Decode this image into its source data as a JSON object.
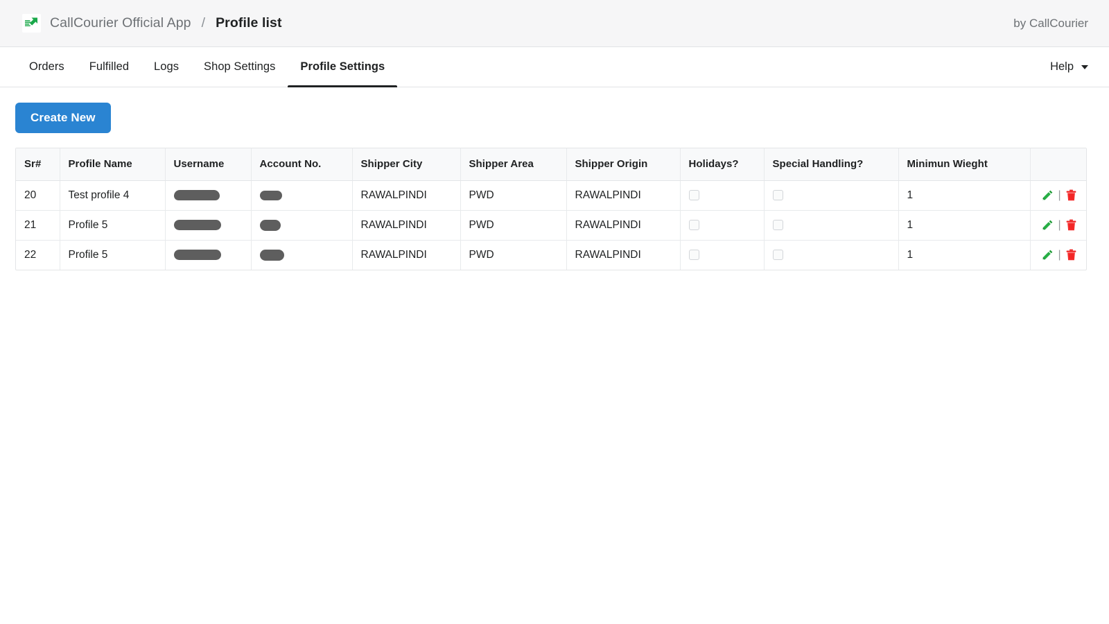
{
  "header": {
    "logo_alt": "CallCourier logo",
    "app_name": "CallCourier Official App",
    "separator": "/",
    "page_title": "Profile list",
    "byline": "by CallCourier"
  },
  "nav": {
    "tabs": [
      {
        "label": "Orders",
        "active": false
      },
      {
        "label": "Fulfilled",
        "active": false
      },
      {
        "label": "Logs",
        "active": false
      },
      {
        "label": "Shop Settings",
        "active": false
      },
      {
        "label": "Profile Settings",
        "active": true
      }
    ],
    "help_label": "Help"
  },
  "toolbar": {
    "create_label": "Create New"
  },
  "table": {
    "columns": [
      "Sr#",
      "Profile Name",
      "Username",
      "Account No.",
      "Shipper City",
      "Shipper Area",
      "Shipper Origin",
      "Holidays?",
      "Special Handling?",
      "Minimun Wieght",
      ""
    ],
    "rows": [
      {
        "sr": "20",
        "profile_name": "Test profile 4",
        "username": "",
        "account_no": "",
        "shipper_city": "RAWALPINDI",
        "shipper_area": "PWD",
        "shipper_origin": "RAWALPINDI",
        "holidays": false,
        "special_handling": false,
        "minimum_weight": "1"
      },
      {
        "sr": "21",
        "profile_name": "Profile 5",
        "username": "",
        "account_no": "",
        "shipper_city": "RAWALPINDI",
        "shipper_area": "PWD",
        "shipper_origin": "RAWALPINDI",
        "holidays": false,
        "special_handling": false,
        "minimum_weight": "1"
      },
      {
        "sr": "22",
        "profile_name": "Profile 5",
        "username": "",
        "account_no": "",
        "shipper_city": "RAWALPINDI",
        "shipper_area": "PWD",
        "shipper_origin": "RAWALPINDI",
        "holidays": false,
        "special_handling": false,
        "minimum_weight": "1"
      }
    ],
    "row_actions": {
      "edit_icon": "pencil-icon",
      "separator": "|",
      "delete_icon": "trash-icon"
    }
  },
  "colors": {
    "primary_button": "#2a84d2",
    "edit_icon": "#22a03c",
    "delete_icon": "#ef2222",
    "redaction": "#5e5e5e",
    "topbar_bg": "#f6f6f7",
    "table_header_bg": "#f8f9fa"
  }
}
